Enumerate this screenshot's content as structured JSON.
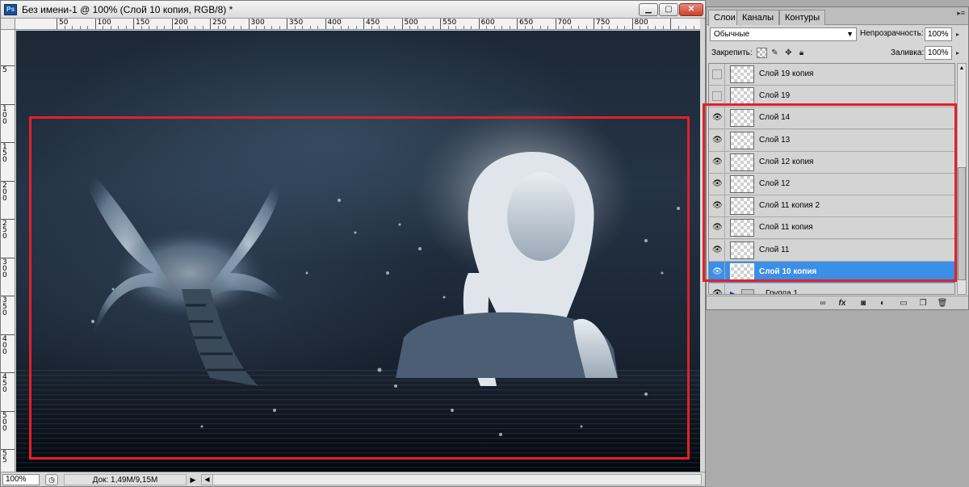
{
  "document": {
    "title": "Без имени-1 @ 100% (Слой 10 копия, RGB/8) *",
    "app_icon": "Ps",
    "window_buttons": [
      "minimize-icon",
      "maximize-icon",
      "close-icon"
    ],
    "ruler_top_labels": [
      "50",
      "100",
      "150",
      "200",
      "250",
      "300",
      "350",
      "400",
      "450",
      "500",
      "550",
      "600",
      "650",
      "700",
      "750",
      "800"
    ],
    "ruler_left_labels": [
      "5",
      "1 0 0",
      "1 5 0",
      "2 0 0",
      "2 5 0",
      "3 0 0",
      "3 5 0",
      "4 0 0",
      "4 5 0",
      "5 0 0",
      "5 5"
    ],
    "status": {
      "zoom": "100%",
      "doc_info": "Док: 1,49M/9,15M"
    }
  },
  "layers_panel": {
    "tabs": [
      "Слои",
      "Каналы",
      "Контуры"
    ],
    "active_tab": "Слои",
    "blend_mode": "Обычные",
    "opacity_label": "Непрозрачность:",
    "opacity_value": "100%",
    "lock_label": "Закрепить:",
    "fill_label": "Заливка:",
    "fill_value": "100%",
    "layers": [
      {
        "name": "Слой 19 копия",
        "visible": false,
        "selected": false
      },
      {
        "name": "Слой 19",
        "visible": false,
        "selected": false
      },
      {
        "name": "Слой 14",
        "visible": true,
        "selected": false
      },
      {
        "name": "Слой 13",
        "visible": true,
        "selected": false
      },
      {
        "name": "Слой 12 копия",
        "visible": true,
        "selected": false
      },
      {
        "name": "Слой 12",
        "visible": true,
        "selected": false
      },
      {
        "name": "Слой 11 копия 2",
        "visible": true,
        "selected": false
      },
      {
        "name": "Слой 11 копия",
        "visible": true,
        "selected": false
      },
      {
        "name": "Слой 11",
        "visible": true,
        "selected": false
      },
      {
        "name": "Слой 10 копия",
        "visible": true,
        "selected": true
      },
      {
        "name": "Группа 1",
        "visible": true,
        "selected": false,
        "is_group": true
      }
    ],
    "footer_icons": [
      "link-icon",
      "fx-icon",
      "mask-icon",
      "adjustment-icon",
      "group-icon",
      "new-layer-icon",
      "trash-icon"
    ]
  },
  "colors": {
    "highlight_red": "#e3202a",
    "selected_layer": "#3b8fe6"
  }
}
